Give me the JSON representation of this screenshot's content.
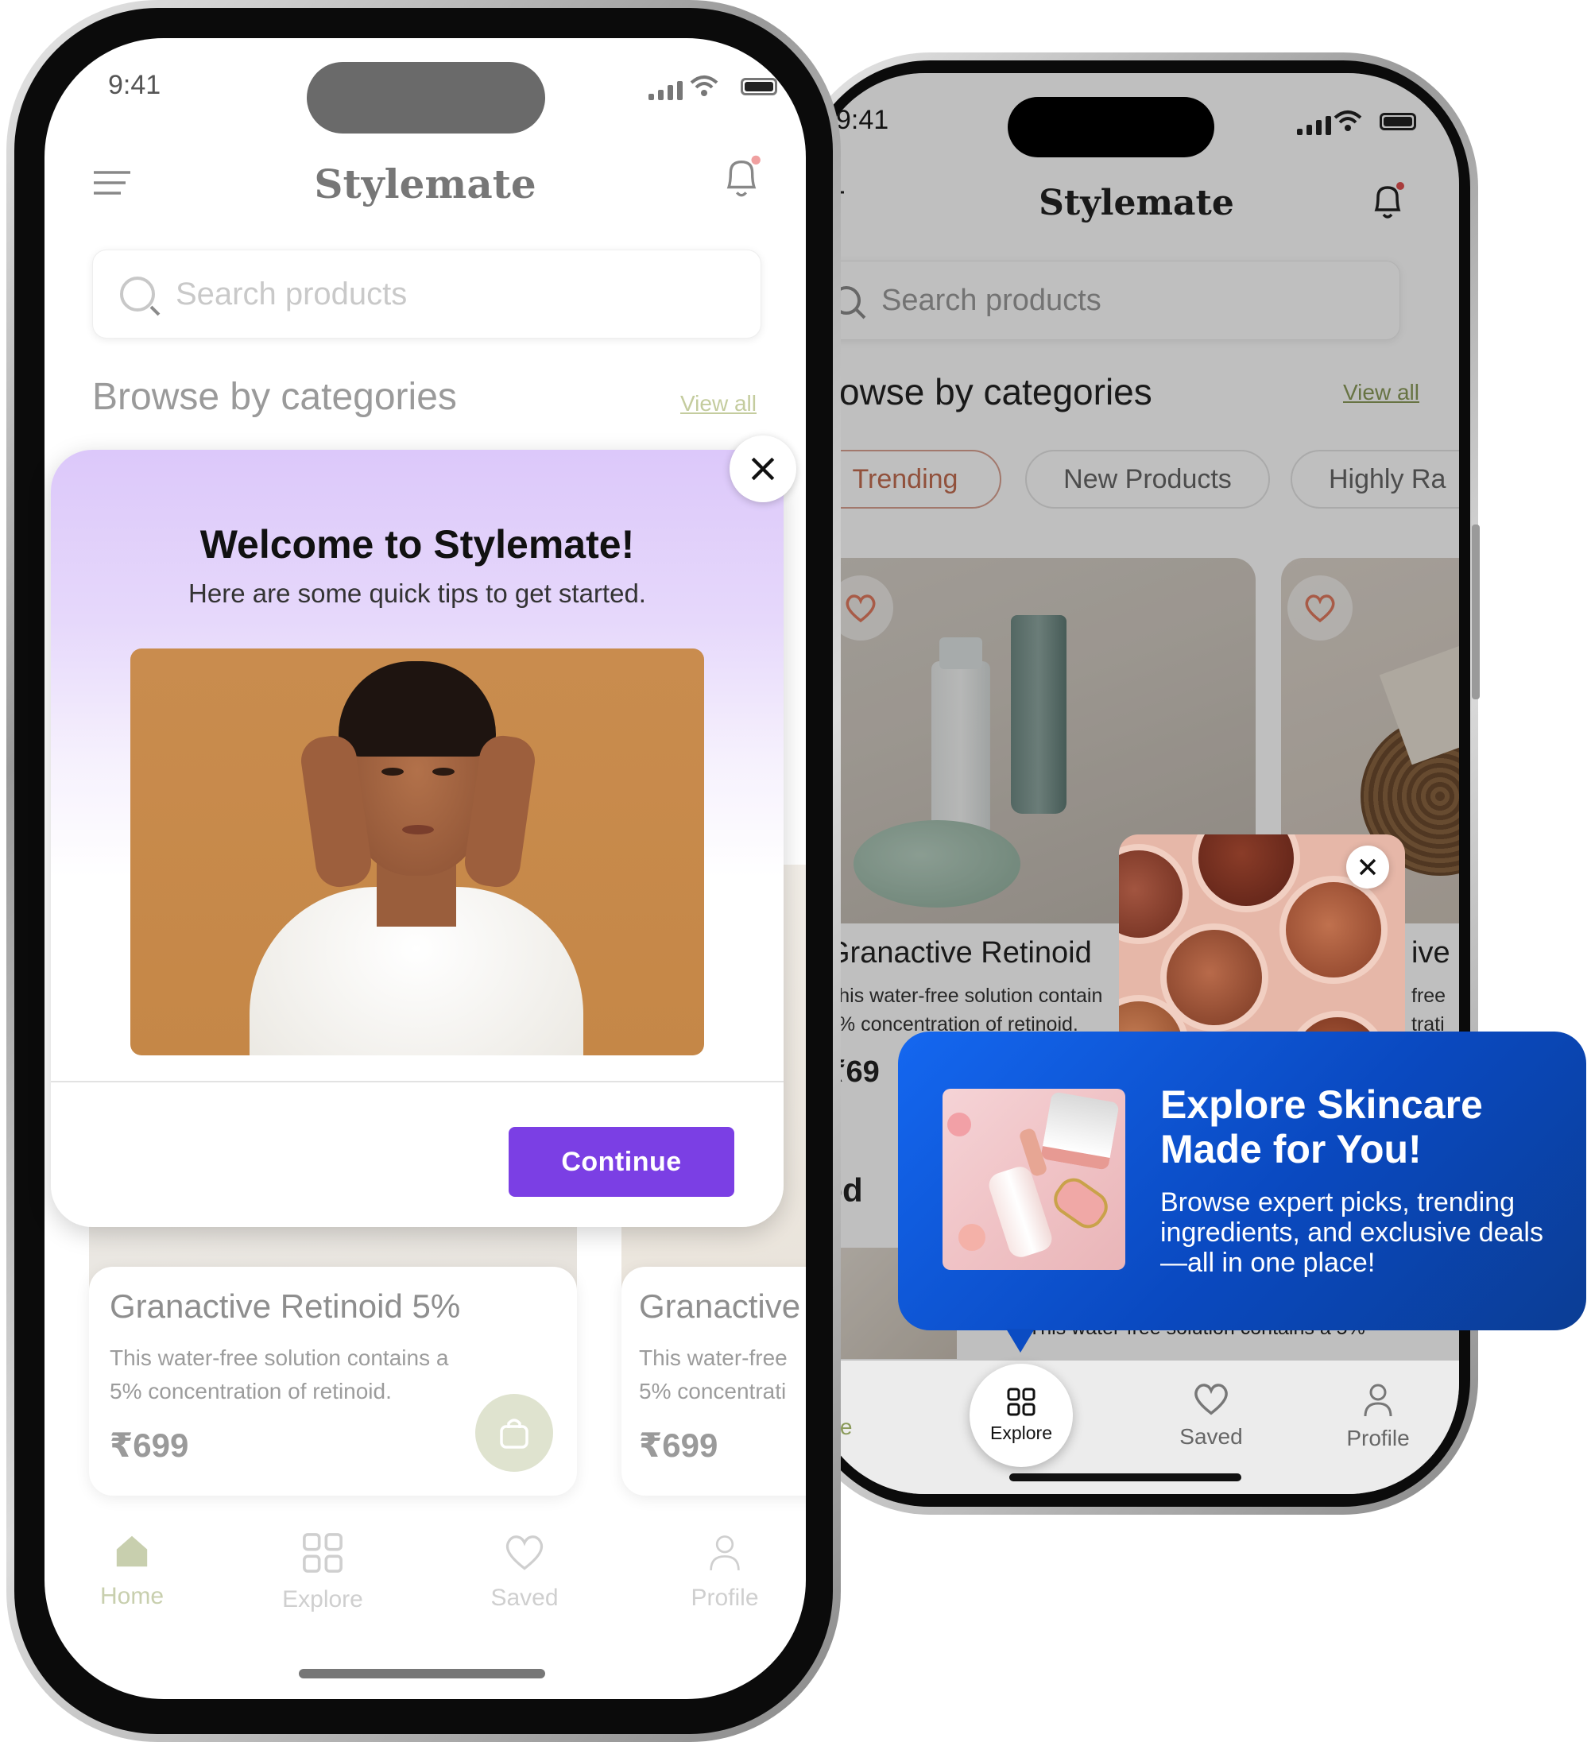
{
  "app_name": "Stylemate",
  "status_time": "9:41",
  "search": {
    "placeholder": "Search products"
  },
  "section": {
    "title": "Browse by categories",
    "view_all": "View all"
  },
  "categories": [
    "Trending",
    "New Products",
    "Highly Ra"
  ],
  "product": {
    "title": "Granactive Retinoid 5%",
    "title_short": "Granactive Retinoid",
    "desc_line1": "This water-free solution contains a",
    "desc_line2": "5% concentration of retinoid.",
    "price": "₹699"
  },
  "back_product": {
    "title": "Granactive",
    "desc_line1": "This water-free",
    "desc_line2": "5% concentrati",
    "price": "₹699"
  },
  "right_partial": {
    "title_tail": "ive",
    "desc1_tail": "free",
    "desc2_tail": "trati",
    "price_partial": "₹69",
    "products_partial": "rod",
    "desc_bottom": "This water-free solution contains a 5%",
    "desc1": "This water-free solution contain",
    "desc2": "5% concentration of retinoid.",
    "card_desc2": "5% concentration of retinoid."
  },
  "welcome_modal": {
    "title": "Welcome to Stylemate!",
    "subtitle": "Here are some quick tips to get started.",
    "continue_label": "Continue"
  },
  "tooltip": {
    "title": "Explore Skincare Made for You!",
    "body": "Browse expert picks, trending ingredients, and exclusive deals —all in one place!"
  },
  "tabs": {
    "home": "Home",
    "home_partial": "ome",
    "explore": "Explore",
    "saved": "Saved",
    "profile": "Profile"
  },
  "colors": {
    "accent_green": "#8a9a5a",
    "modal_purple": "#dcc8fa",
    "continue_purple": "#7b3fe4",
    "tooltip_blue": "#0a49c0",
    "chip_active": "#c26c50"
  }
}
